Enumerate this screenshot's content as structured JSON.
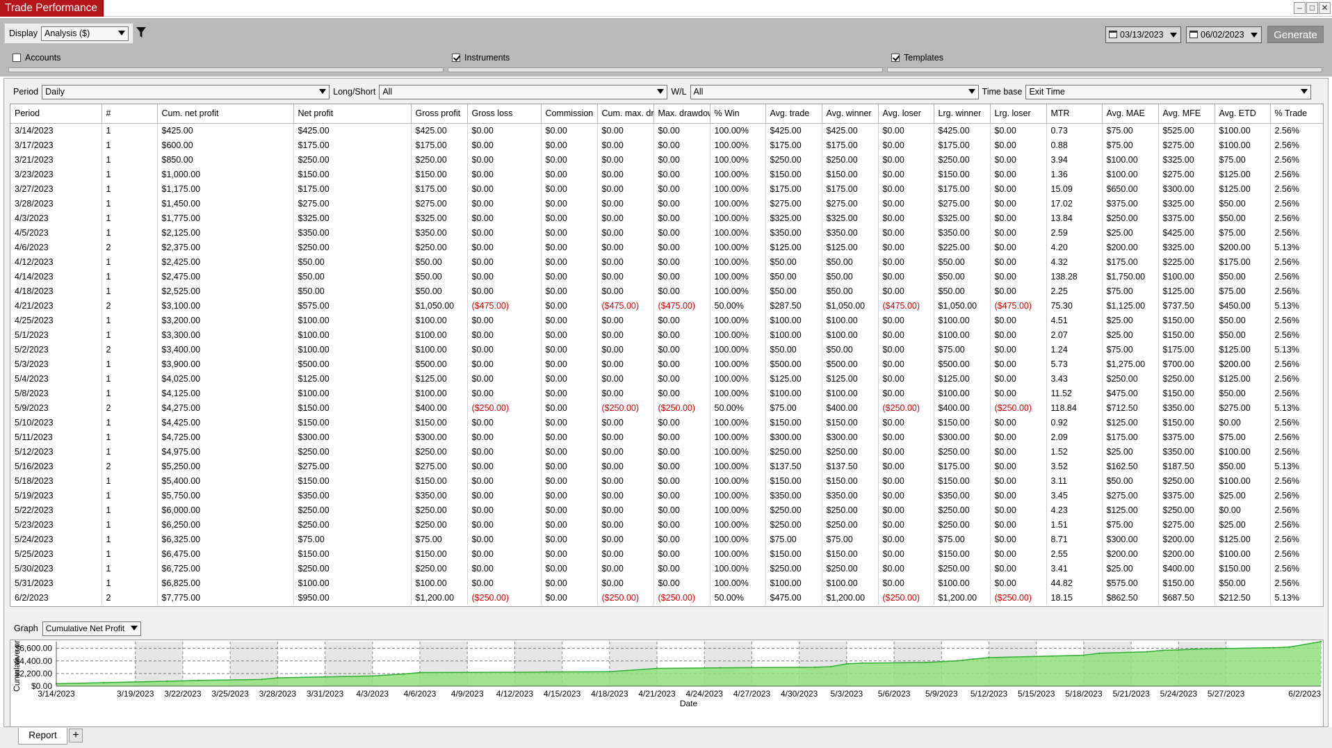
{
  "window": {
    "title": "Trade Performance",
    "buttons": [
      "–",
      "□",
      "✕"
    ]
  },
  "toolbar": {
    "display_label": "Display",
    "display_value": "Analysis ($)",
    "start_date": "03/13/2023",
    "end_date": "06/02/2023",
    "generate_label": "Generate",
    "accounts_label": "Accounts",
    "accounts_checked": false,
    "instruments_label": "Instruments",
    "instruments_checked": true,
    "templates_label": "Templates",
    "templates_checked": true
  },
  "filters": {
    "period_label": "Period",
    "period_value": "Daily",
    "longshort_label": "Long/Short",
    "longshort_value": "All",
    "wl_label": "W/L",
    "wl_value": "All",
    "timebase_label": "Time base",
    "timebase_value": "Exit Time"
  },
  "table": {
    "columns": [
      "Period",
      "#",
      "Cum. net profit",
      "Net profit",
      "Gross profit",
      "Gross loss",
      "Commission",
      "Cum. max. drawdown",
      "Max. drawdown",
      "% Win",
      "Avg. trade",
      "Avg. winner",
      "Avg. loser",
      "Lrg. winner",
      "Lrg. loser",
      "MTR",
      "Avg. MAE",
      "Avg. MFE",
      "Avg. ETD",
      "% Trade"
    ],
    "rows": [
      [
        "3/14/2023",
        "1",
        "$425.00",
        "$425.00",
        "$425.00",
        "$0.00",
        "$0.00",
        "$0.00",
        "$0.00",
        "100.00%",
        "$425.00",
        "$425.00",
        "$0.00",
        "$425.00",
        "$0.00",
        "0.73",
        "$75.00",
        "$525.00",
        "$100.00",
        "2.56%"
      ],
      [
        "3/17/2023",
        "1",
        "$600.00",
        "$175.00",
        "$175.00",
        "$0.00",
        "$0.00",
        "$0.00",
        "$0.00",
        "100.00%",
        "$175.00",
        "$175.00",
        "$0.00",
        "$175.00",
        "$0.00",
        "0.88",
        "$75.00",
        "$275.00",
        "$100.00",
        "2.56%"
      ],
      [
        "3/21/2023",
        "1",
        "$850.00",
        "$250.00",
        "$250.00",
        "$0.00",
        "$0.00",
        "$0.00",
        "$0.00",
        "100.00%",
        "$250.00",
        "$250.00",
        "$0.00",
        "$250.00",
        "$0.00",
        "3.94",
        "$100.00",
        "$325.00",
        "$75.00",
        "2.56%"
      ],
      [
        "3/23/2023",
        "1",
        "$1,000.00",
        "$150.00",
        "$150.00",
        "$0.00",
        "$0.00",
        "$0.00",
        "$0.00",
        "100.00%",
        "$150.00",
        "$150.00",
        "$0.00",
        "$150.00",
        "$0.00",
        "1.36",
        "$100.00",
        "$275.00",
        "$125.00",
        "2.56%"
      ],
      [
        "3/27/2023",
        "1",
        "$1,175.00",
        "$175.00",
        "$175.00",
        "$0.00",
        "$0.00",
        "$0.00",
        "$0.00",
        "100.00%",
        "$175.00",
        "$175.00",
        "$0.00",
        "$175.00",
        "$0.00",
        "15.09",
        "$650.00",
        "$300.00",
        "$125.00",
        "2.56%"
      ],
      [
        "3/28/2023",
        "1",
        "$1,450.00",
        "$275.00",
        "$275.00",
        "$0.00",
        "$0.00",
        "$0.00",
        "$0.00",
        "100.00%",
        "$275.00",
        "$275.00",
        "$0.00",
        "$275.00",
        "$0.00",
        "17.02",
        "$375.00",
        "$325.00",
        "$50.00",
        "2.56%"
      ],
      [
        "4/3/2023",
        "1",
        "$1,775.00",
        "$325.00",
        "$325.00",
        "$0.00",
        "$0.00",
        "$0.00",
        "$0.00",
        "100.00%",
        "$325.00",
        "$325.00",
        "$0.00",
        "$325.00",
        "$0.00",
        "13.84",
        "$250.00",
        "$375.00",
        "$50.00",
        "2.56%"
      ],
      [
        "4/5/2023",
        "1",
        "$2,125.00",
        "$350.00",
        "$350.00",
        "$0.00",
        "$0.00",
        "$0.00",
        "$0.00",
        "100.00%",
        "$350.00",
        "$350.00",
        "$0.00",
        "$350.00",
        "$0.00",
        "2.59",
        "$25.00",
        "$425.00",
        "$75.00",
        "2.56%"
      ],
      [
        "4/6/2023",
        "2",
        "$2,375.00",
        "$250.00",
        "$250.00",
        "$0.00",
        "$0.00",
        "$0.00",
        "$0.00",
        "100.00%",
        "$125.00",
        "$125.00",
        "$0.00",
        "$225.00",
        "$0.00",
        "4.20",
        "$200.00",
        "$325.00",
        "$200.00",
        "5.13%"
      ],
      [
        "4/12/2023",
        "1",
        "$2,425.00",
        "$50.00",
        "$50.00",
        "$0.00",
        "$0.00",
        "$0.00",
        "$0.00",
        "100.00%",
        "$50.00",
        "$50.00",
        "$0.00",
        "$50.00",
        "$0.00",
        "4.32",
        "$175.00",
        "$225.00",
        "$175.00",
        "2.56%"
      ],
      [
        "4/14/2023",
        "1",
        "$2,475.00",
        "$50.00",
        "$50.00",
        "$0.00",
        "$0.00",
        "$0.00",
        "$0.00",
        "100.00%",
        "$50.00",
        "$50.00",
        "$0.00",
        "$50.00",
        "$0.00",
        "138.28",
        "$1,750.00",
        "$100.00",
        "$50.00",
        "2.56%"
      ],
      [
        "4/18/2023",
        "1",
        "$2,525.00",
        "$50.00",
        "$50.00",
        "$0.00",
        "$0.00",
        "$0.00",
        "$0.00",
        "100.00%",
        "$50.00",
        "$50.00",
        "$0.00",
        "$50.00",
        "$0.00",
        "2.25",
        "$75.00",
        "$125.00",
        "$75.00",
        "2.56%"
      ],
      [
        "4/21/2023",
        "2",
        "$3,100.00",
        "$575.00",
        "$1,050.00",
        "($475.00)",
        "$0.00",
        "($475.00)",
        "($475.00)",
        "50.00%",
        "$287.50",
        "$1,050.00",
        "($475.00)",
        "$1,050.00",
        "($475.00)",
        "75.30",
        "$1,125.00",
        "$737.50",
        "$450.00",
        "5.13%"
      ],
      [
        "4/25/2023",
        "1",
        "$3,200.00",
        "$100.00",
        "$100.00",
        "$0.00",
        "$0.00",
        "$0.00",
        "$0.00",
        "100.00%",
        "$100.00",
        "$100.00",
        "$0.00",
        "$100.00",
        "$0.00",
        "4.51",
        "$25.00",
        "$150.00",
        "$50.00",
        "2.56%"
      ],
      [
        "5/1/2023",
        "1",
        "$3,300.00",
        "$100.00",
        "$100.00",
        "$0.00",
        "$0.00",
        "$0.00",
        "$0.00",
        "100.00%",
        "$100.00",
        "$100.00",
        "$0.00",
        "$100.00",
        "$0.00",
        "2.07",
        "$25.00",
        "$150.00",
        "$50.00",
        "2.56%"
      ],
      [
        "5/2/2023",
        "2",
        "$3,400.00",
        "$100.00",
        "$100.00",
        "$0.00",
        "$0.00",
        "$0.00",
        "$0.00",
        "100.00%",
        "$50.00",
        "$50.00",
        "$0.00",
        "$75.00",
        "$0.00",
        "1.24",
        "$75.00",
        "$175.00",
        "$125.00",
        "5.13%"
      ],
      [
        "5/3/2023",
        "1",
        "$3,900.00",
        "$500.00",
        "$500.00",
        "$0.00",
        "$0.00",
        "$0.00",
        "$0.00",
        "100.00%",
        "$500.00",
        "$500.00",
        "$0.00",
        "$500.00",
        "$0.00",
        "5.73",
        "$1,275.00",
        "$700.00",
        "$200.00",
        "2.56%"
      ],
      [
        "5/4/2023",
        "1",
        "$4,025.00",
        "$125.00",
        "$125.00",
        "$0.00",
        "$0.00",
        "$0.00",
        "$0.00",
        "100.00%",
        "$125.00",
        "$125.00",
        "$0.00",
        "$125.00",
        "$0.00",
        "3.43",
        "$250.00",
        "$250.00",
        "$125.00",
        "2.56%"
      ],
      [
        "5/8/2023",
        "1",
        "$4,125.00",
        "$100.00",
        "$100.00",
        "$0.00",
        "$0.00",
        "$0.00",
        "$0.00",
        "100.00%",
        "$100.00",
        "$100.00",
        "$0.00",
        "$100.00",
        "$0.00",
        "11.52",
        "$475.00",
        "$150.00",
        "$50.00",
        "2.56%"
      ],
      [
        "5/9/2023",
        "2",
        "$4,275.00",
        "$150.00",
        "$400.00",
        "($250.00)",
        "$0.00",
        "($250.00)",
        "($250.00)",
        "50.00%",
        "$75.00",
        "$400.00",
        "($250.00)",
        "$400.00",
        "($250.00)",
        "118.84",
        "$712.50",
        "$350.00",
        "$275.00",
        "5.13%"
      ],
      [
        "5/10/2023",
        "1",
        "$4,425.00",
        "$150.00",
        "$150.00",
        "$0.00",
        "$0.00",
        "$0.00",
        "$0.00",
        "100.00%",
        "$150.00",
        "$150.00",
        "$0.00",
        "$150.00",
        "$0.00",
        "0.92",
        "$125.00",
        "$150.00",
        "$0.00",
        "2.56%"
      ],
      [
        "5/11/2023",
        "1",
        "$4,725.00",
        "$300.00",
        "$300.00",
        "$0.00",
        "$0.00",
        "$0.00",
        "$0.00",
        "100.00%",
        "$300.00",
        "$300.00",
        "$0.00",
        "$300.00",
        "$0.00",
        "2.09",
        "$175.00",
        "$375.00",
        "$75.00",
        "2.56%"
      ],
      [
        "5/12/2023",
        "1",
        "$4,975.00",
        "$250.00",
        "$250.00",
        "$0.00",
        "$0.00",
        "$0.00",
        "$0.00",
        "100.00%",
        "$250.00",
        "$250.00",
        "$0.00",
        "$250.00",
        "$0.00",
        "1.52",
        "$25.00",
        "$350.00",
        "$100.00",
        "2.56%"
      ],
      [
        "5/16/2023",
        "2",
        "$5,250.00",
        "$275.00",
        "$275.00",
        "$0.00",
        "$0.00",
        "$0.00",
        "$0.00",
        "100.00%",
        "$137.50",
        "$137.50",
        "$0.00",
        "$175.00",
        "$0.00",
        "3.52",
        "$162.50",
        "$187.50",
        "$50.00",
        "5.13%"
      ],
      [
        "5/18/2023",
        "1",
        "$5,400.00",
        "$150.00",
        "$150.00",
        "$0.00",
        "$0.00",
        "$0.00",
        "$0.00",
        "100.00%",
        "$150.00",
        "$150.00",
        "$0.00",
        "$150.00",
        "$0.00",
        "3.11",
        "$50.00",
        "$250.00",
        "$100.00",
        "2.56%"
      ],
      [
        "5/19/2023",
        "1",
        "$5,750.00",
        "$350.00",
        "$350.00",
        "$0.00",
        "$0.00",
        "$0.00",
        "$0.00",
        "100.00%",
        "$350.00",
        "$350.00",
        "$0.00",
        "$350.00",
        "$0.00",
        "3.45",
        "$275.00",
        "$375.00",
        "$25.00",
        "2.56%"
      ],
      [
        "5/22/2023",
        "1",
        "$6,000.00",
        "$250.00",
        "$250.00",
        "$0.00",
        "$0.00",
        "$0.00",
        "$0.00",
        "100.00%",
        "$250.00",
        "$250.00",
        "$0.00",
        "$250.00",
        "$0.00",
        "4.23",
        "$125.00",
        "$250.00",
        "$0.00",
        "2.56%"
      ],
      [
        "5/23/2023",
        "1",
        "$6,250.00",
        "$250.00",
        "$250.00",
        "$0.00",
        "$0.00",
        "$0.00",
        "$0.00",
        "100.00%",
        "$250.00",
        "$250.00",
        "$0.00",
        "$250.00",
        "$0.00",
        "1.51",
        "$75.00",
        "$275.00",
        "$25.00",
        "2.56%"
      ],
      [
        "5/24/2023",
        "1",
        "$6,325.00",
        "$75.00",
        "$75.00",
        "$0.00",
        "$0.00",
        "$0.00",
        "$0.00",
        "100.00%",
        "$75.00",
        "$75.00",
        "$0.00",
        "$75.00",
        "$0.00",
        "8.71",
        "$300.00",
        "$200.00",
        "$125.00",
        "2.56%"
      ],
      [
        "5/25/2023",
        "1",
        "$6,475.00",
        "$150.00",
        "$150.00",
        "$0.00",
        "$0.00",
        "$0.00",
        "$0.00",
        "100.00%",
        "$150.00",
        "$150.00",
        "$0.00",
        "$150.00",
        "$0.00",
        "2.55",
        "$200.00",
        "$200.00",
        "$100.00",
        "2.56%"
      ],
      [
        "5/30/2023",
        "1",
        "$6,725.00",
        "$250.00",
        "$250.00",
        "$0.00",
        "$0.00",
        "$0.00",
        "$0.00",
        "100.00%",
        "$250.00",
        "$250.00",
        "$0.00",
        "$250.00",
        "$0.00",
        "3.41",
        "$25.00",
        "$400.00",
        "$150.00",
        "2.56%"
      ],
      [
        "5/31/2023",
        "1",
        "$6,825.00",
        "$100.00",
        "$100.00",
        "$0.00",
        "$0.00",
        "$0.00",
        "$0.00",
        "100.00%",
        "$100.00",
        "$100.00",
        "$0.00",
        "$100.00",
        "$0.00",
        "44.82",
        "$575.00",
        "$150.00",
        "$50.00",
        "2.56%"
      ],
      [
        "6/2/2023",
        "2",
        "$7,775.00",
        "$950.00",
        "$1,200.00",
        "($250.00)",
        "$0.00",
        "($250.00)",
        "($250.00)",
        "50.00%",
        "$475.00",
        "$1,200.00",
        "($250.00)",
        "$1,200.00",
        "($250.00)",
        "18.15",
        "$862.50",
        "$687.50",
        "$212.50",
        "5.13%"
      ]
    ]
  },
  "graph": {
    "label": "Graph",
    "selector_value": "Cumulative Net Profit"
  },
  "chart_data": {
    "type": "area",
    "xlabel": "Date",
    "ylabel": "Cumulative profit",
    "ylim": [
      0,
      7775
    ],
    "yticks": [
      "$6,600.00",
      "$4,400.00",
      "$2,200.00",
      "$0.00"
    ],
    "ytick_values": [
      6600,
      4400,
      2200,
      0
    ],
    "xticks": [
      "3/14/2023",
      "3/19/2023",
      "3/22/2023",
      "3/25/2023",
      "3/28/2023",
      "3/31/2023",
      "4/3/2023",
      "4/6/2023",
      "4/9/2023",
      "4/12/2023",
      "4/15/2023",
      "4/18/2023",
      "4/21/2023",
      "4/24/2023",
      "4/27/2023",
      "4/30/2023",
      "5/3/2023",
      "5/6/2023",
      "5/9/2023",
      "5/12/2023",
      "5/15/2023",
      "5/18/2023",
      "5/21/2023",
      "5/24/2023",
      "5/27/2023",
      "6/2/2023"
    ],
    "x": [
      "3/14/2023",
      "3/17/2023",
      "3/21/2023",
      "3/23/2023",
      "3/27/2023",
      "3/28/2023",
      "4/3/2023",
      "4/5/2023",
      "4/6/2023",
      "4/12/2023",
      "4/14/2023",
      "4/18/2023",
      "4/21/2023",
      "4/25/2023",
      "5/1/2023",
      "5/2/2023",
      "5/3/2023",
      "5/4/2023",
      "5/8/2023",
      "5/9/2023",
      "5/10/2023",
      "5/11/2023",
      "5/12/2023",
      "5/16/2023",
      "5/18/2023",
      "5/19/2023",
      "5/22/2023",
      "5/23/2023",
      "5/24/2023",
      "5/25/2023",
      "5/30/2023",
      "5/31/2023",
      "6/2/2023"
    ],
    "values": [
      425,
      600,
      850,
      1000,
      1175,
      1450,
      1775,
      2125,
      2375,
      2425,
      2475,
      2525,
      3100,
      3200,
      3300,
      3400,
      3900,
      4025,
      4125,
      4275,
      4425,
      4725,
      4975,
      5250,
      5400,
      5750,
      6000,
      6250,
      6325,
      6475,
      6725,
      6825,
      7775
    ],
    "grid": true,
    "colors": {
      "fill": "#90e07c",
      "line": "#2fae2f",
      "band": "#e6e6e6"
    }
  },
  "bottom_tabs": {
    "report_label": "Report",
    "add_label": "+"
  }
}
